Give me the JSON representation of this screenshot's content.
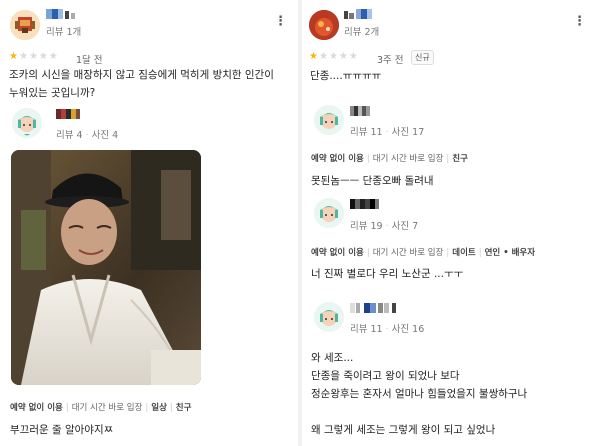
{
  "left_review": {
    "reviewer_stats": "리뷰 1개",
    "rating": 1,
    "time_ago": "1달 전",
    "text_line1": "조카의 시신을 매장하지 않고 짐승에게 먹히게 방치한 인간이",
    "text_line2": "누워있는 곳입니까?",
    "reply_stats_reviews": "리뷰 4",
    "reply_stats_photos": "사진 4",
    "tags": [
      "예약 없이 이용",
      "대기 시간 바로 입장",
      "일상",
      "친구"
    ],
    "comment": "부끄러운 줄 알아야지ㅉ"
  },
  "right_review": {
    "reviewer_stats": "리뷰 2개",
    "rating": 1,
    "time_ago": "3주 전",
    "badge": "신규",
    "text": "단종....ㅠㅠㅠㅠ",
    "replies": [
      {
        "stats_reviews": "리뷰 11",
        "stats_photos": "사진 17",
        "tags": [
          "예약 없이 이용",
          "대기 시간 바로 입장",
          "친구"
        ],
        "text": "못된놈ㅡㅡ 단종오빠 돌려내"
      },
      {
        "stats_reviews": "리뷰 19",
        "stats_photos": "사진 7",
        "tags": [
          "예약 없이 이용",
          "대기 시간 바로 입장",
          "데이트",
          "연인 • 배우자"
        ],
        "text": "너 진짜 별로다 우리 노산군 ...ㅜㅜ"
      },
      {
        "stats_reviews": "리뷰 11",
        "stats_photos": "사진 16",
        "text_lines": [
          "와 세조...",
          "단종을 죽이려고 왕이 되었나 보다",
          "정순왕후는 혼자서 얼마나 힘들었을지 불쌍하구나",
          "",
          "왜 그렇게 세조는 그렇게 왕이 되고 싶었나"
        ]
      }
    ]
  },
  "icons": {
    "more": "more-vertical-icon",
    "star": "star-icon"
  },
  "colors": {
    "star": "#f6b60a",
    "star_empty": "#dadada",
    "avatar_bg": "#eaf6f2",
    "avatar_skin": "#f5d2b8",
    "avatar_cap": "#4fb7a2"
  }
}
